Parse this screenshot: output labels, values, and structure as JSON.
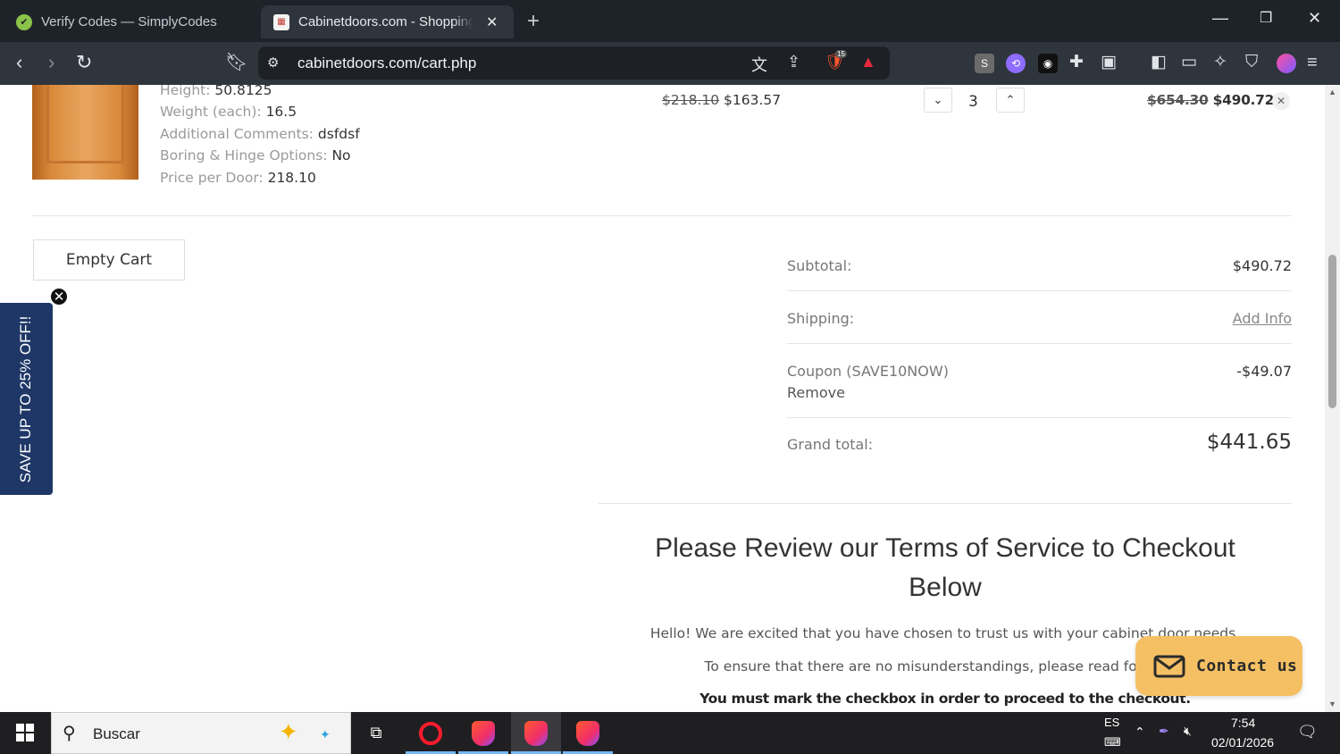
{
  "browser": {
    "tabs": [
      {
        "title": "Verify Codes — SimplyCodes",
        "active": false
      },
      {
        "title": "Cabinetdoors.com - Shopping Cart",
        "active": true
      }
    ],
    "url": "cabinetdoors.com/cart.php",
    "brave_shield_count": "15",
    "extension_badge_s": "S"
  },
  "cart_item": {
    "specs": [
      {
        "label": "Height:",
        "value": "50.8125"
      },
      {
        "label": "Weight (each):",
        "value": "16.5"
      },
      {
        "label": "Additional Comments:",
        "value": "dsfdsf"
      },
      {
        "label": "Boring & Hinge Options:",
        "value": "No"
      },
      {
        "label": "Price per Door:",
        "value": "218.10"
      }
    ],
    "unit_price_old": "$218.10",
    "unit_price_new": "$163.57",
    "quantity": "3",
    "total_old": "$654.30",
    "total_new": "$490.72"
  },
  "empty_cart_label": "Empty Cart",
  "totals": {
    "subtotal_label": "Subtotal:",
    "subtotal_value": "$490.72",
    "shipping_label": "Shipping:",
    "shipping_value": "Add Info",
    "coupon_label": "Coupon (SAVE10NOW)",
    "coupon_value": "-$49.07",
    "coupon_remove": "Remove",
    "grand_label": "Grand total:",
    "grand_value": "$441.65"
  },
  "terms": {
    "title": "Please Review our Terms of Service to Checkout Below",
    "p1": "Hello! We are excited that you have chosen to trust us with your cabinet door needs.",
    "p2": "To ensure that there are no misunderstandings, please read following",
    "p3": "You must mark the checkbox in order to proceed to the checkout."
  },
  "promo_tab": "SAVE UP TO 25% OFF!!",
  "contact_label": "Contact us",
  "taskbar": {
    "search_placeholder": "Buscar",
    "language": "ES",
    "time": "7:54",
    "date": "02/01/2026"
  },
  "colors": {
    "promo_bg": "#1e3766",
    "contact_bg": "#f5c064",
    "chrome_bg": "#2f353d"
  }
}
